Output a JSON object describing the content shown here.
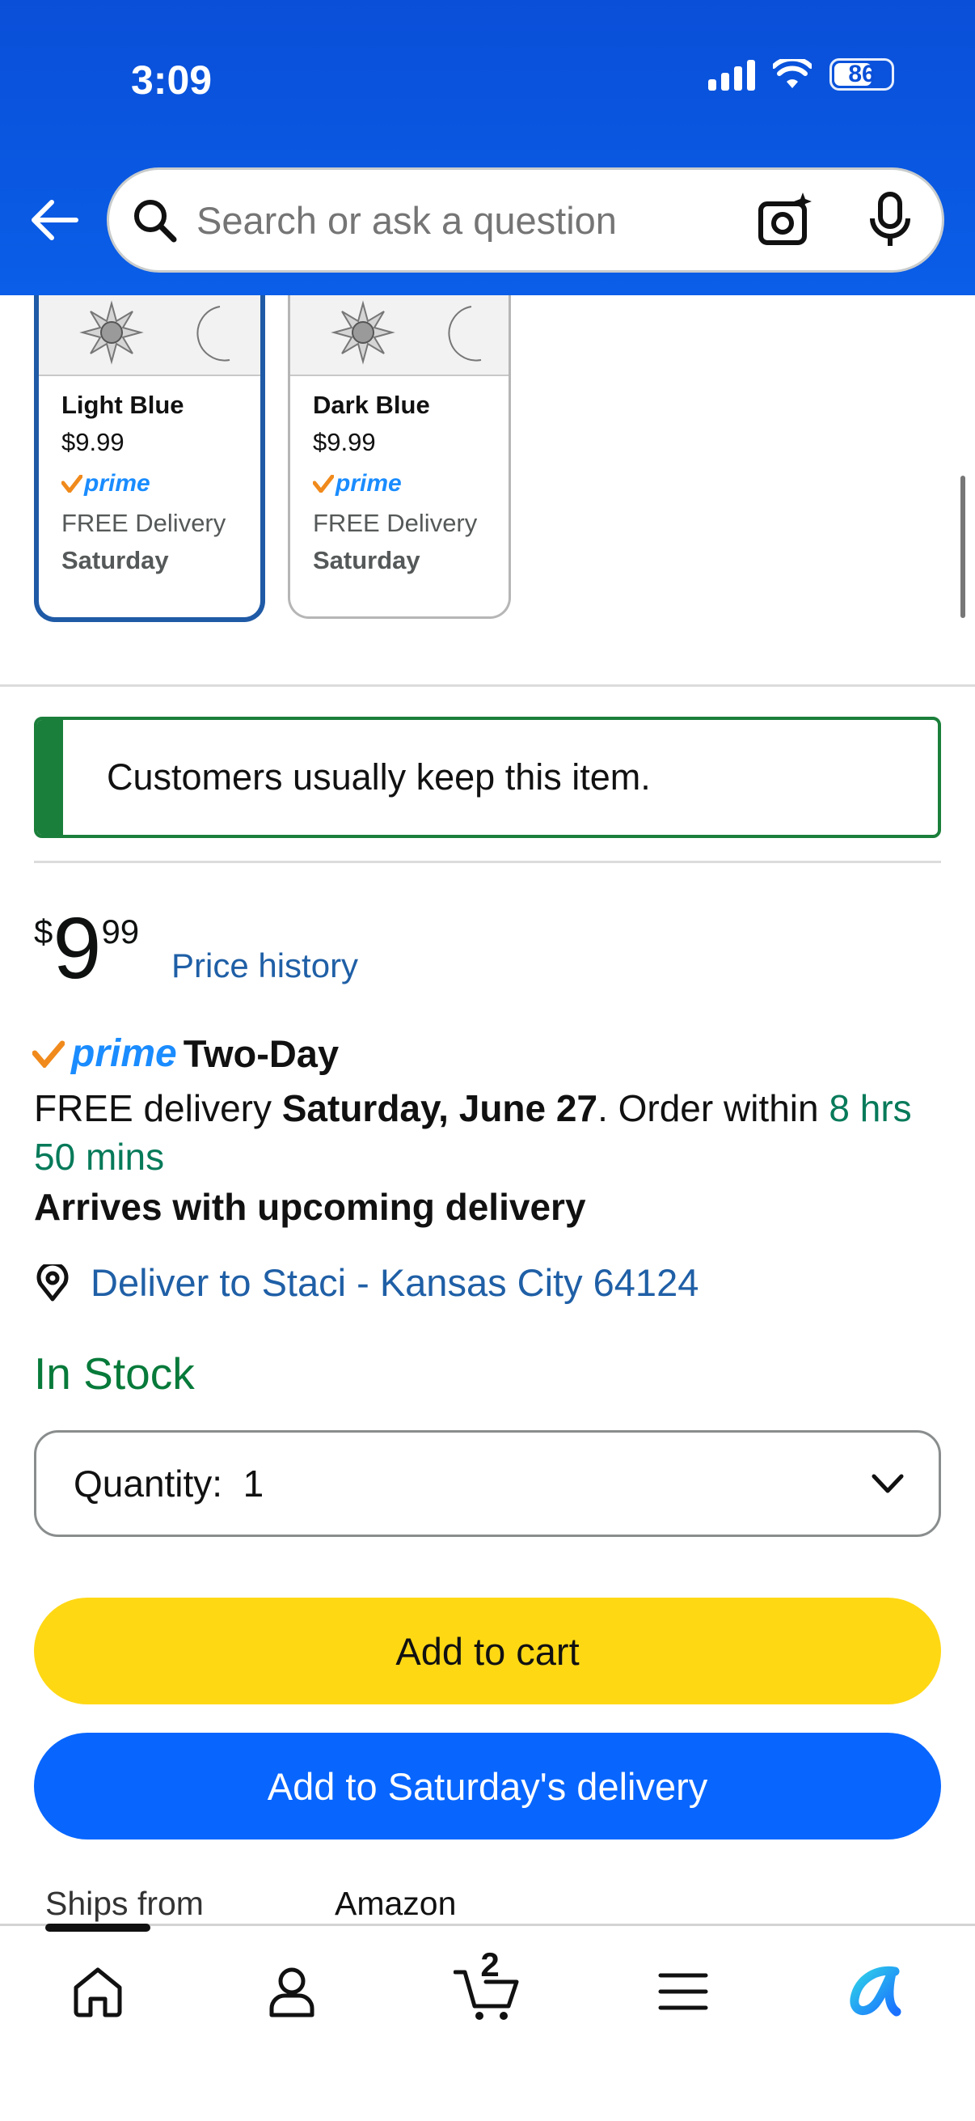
{
  "status_bar": {
    "time": "3:09",
    "battery": "86"
  },
  "search": {
    "placeholder": "Search or ask a question"
  },
  "variants": [
    {
      "name": "Light Blue",
      "price": "$9.99",
      "prime": "prime",
      "delivery": "FREE Delivery",
      "day": "Saturday",
      "selected": true
    },
    {
      "name": "Dark Blue",
      "price": "$9.99",
      "prime": "prime",
      "delivery": "FREE Delivery",
      "day": "Saturday",
      "selected": false
    }
  ],
  "notice": {
    "text": "Customers usually keep this item."
  },
  "price": {
    "symbol": "$",
    "dollars": "9",
    "cents": "99",
    "history_link": "Price history"
  },
  "prime_delivery": {
    "brand": "prime",
    "speed": "Two-Day",
    "free_delivery_prefix": "FREE delivery ",
    "date": "Saturday, June 27",
    "order_within_prefix": ". Order within ",
    "countdown": "8 hrs 50 mins",
    "arrives_note": "Arrives with upcoming delivery"
  },
  "deliver_to": {
    "text": "Deliver to Staci - Kansas City 64124"
  },
  "stock": {
    "status": "In Stock"
  },
  "quantity": {
    "label": "Quantity:",
    "value": "1"
  },
  "buttons": {
    "add_to_cart": "Add to cart",
    "add_to_delivery": "Add to Saturday's delivery"
  },
  "ships_from": {
    "label": "Ships from",
    "value": "Amazon"
  },
  "bottom_nav": {
    "cart_count": "2"
  },
  "colors": {
    "header_blue": "#0a5ee8",
    "cart_yellow": "#ffd814",
    "delivery_blue": "#0866ff",
    "stock_green": "#077a3a",
    "link_blue": "#1f5fa6"
  }
}
